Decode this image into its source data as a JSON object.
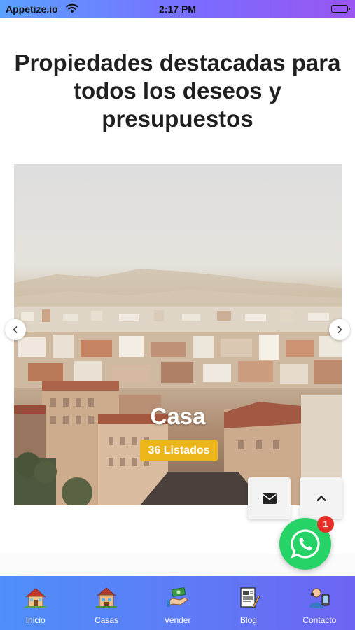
{
  "status_bar": {
    "carrier": "Appetize.io",
    "time": "2:17 PM",
    "wifi_icon": "wifi-icon",
    "battery_icon": "battery-full-icon"
  },
  "heading": "Propiedades destacadas para todos los deseos y presupuestos",
  "carousel": {
    "title": "Casa",
    "badge": "36 Listados",
    "prev_icon": "chevron-left-icon",
    "next_icon": "chevron-right-icon"
  },
  "floating": {
    "mail_icon": "envelope-icon",
    "top_icon": "chevron-up-icon",
    "whatsapp_icon": "whatsapp-icon",
    "whatsapp_badge": "1"
  },
  "bottom_nav": {
    "items": [
      {
        "label": "Inicio",
        "icon": "house-icon"
      },
      {
        "label": "Casas",
        "icon": "houses-icon"
      },
      {
        "label": "Vender",
        "icon": "money-hand-icon"
      },
      {
        "label": "Blog",
        "icon": "blog-document-icon"
      },
      {
        "label": "Contacto",
        "icon": "contact-phone-icon"
      }
    ]
  },
  "colors": {
    "status_gradient": [
      "#5aa0ff",
      "#9a55f2"
    ],
    "badge": "#ecb51a",
    "whatsapp": "#26d366",
    "notification": "#e7302a",
    "nav_gradient": [
      "#4f8ff9",
      "#6d64f3"
    ]
  }
}
